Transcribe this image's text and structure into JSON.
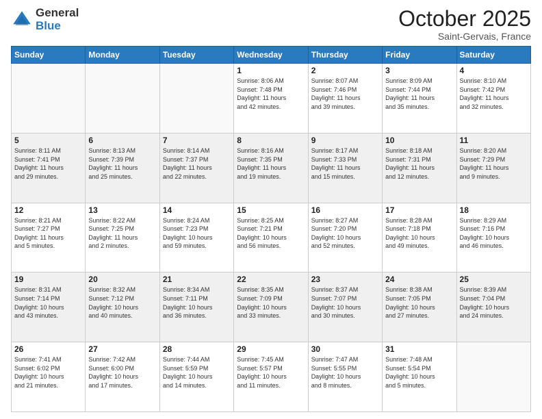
{
  "logo": {
    "general": "General",
    "blue": "Blue"
  },
  "header": {
    "month": "October 2025",
    "location": "Saint-Gervais, France"
  },
  "weekdays": [
    "Sunday",
    "Monday",
    "Tuesday",
    "Wednesday",
    "Thursday",
    "Friday",
    "Saturday"
  ],
  "weeks": [
    [
      {
        "day": "",
        "info": ""
      },
      {
        "day": "",
        "info": ""
      },
      {
        "day": "",
        "info": ""
      },
      {
        "day": "1",
        "info": "Sunrise: 8:06 AM\nSunset: 7:48 PM\nDaylight: 11 hours\nand 42 minutes."
      },
      {
        "day": "2",
        "info": "Sunrise: 8:07 AM\nSunset: 7:46 PM\nDaylight: 11 hours\nand 39 minutes."
      },
      {
        "day": "3",
        "info": "Sunrise: 8:09 AM\nSunset: 7:44 PM\nDaylight: 11 hours\nand 35 minutes."
      },
      {
        "day": "4",
        "info": "Sunrise: 8:10 AM\nSunset: 7:42 PM\nDaylight: 11 hours\nand 32 minutes."
      }
    ],
    [
      {
        "day": "5",
        "info": "Sunrise: 8:11 AM\nSunset: 7:41 PM\nDaylight: 11 hours\nand 29 minutes."
      },
      {
        "day": "6",
        "info": "Sunrise: 8:13 AM\nSunset: 7:39 PM\nDaylight: 11 hours\nand 25 minutes."
      },
      {
        "day": "7",
        "info": "Sunrise: 8:14 AM\nSunset: 7:37 PM\nDaylight: 11 hours\nand 22 minutes."
      },
      {
        "day": "8",
        "info": "Sunrise: 8:16 AM\nSunset: 7:35 PM\nDaylight: 11 hours\nand 19 minutes."
      },
      {
        "day": "9",
        "info": "Sunrise: 8:17 AM\nSunset: 7:33 PM\nDaylight: 11 hours\nand 15 minutes."
      },
      {
        "day": "10",
        "info": "Sunrise: 8:18 AM\nSunset: 7:31 PM\nDaylight: 11 hours\nand 12 minutes."
      },
      {
        "day": "11",
        "info": "Sunrise: 8:20 AM\nSunset: 7:29 PM\nDaylight: 11 hours\nand 9 minutes."
      }
    ],
    [
      {
        "day": "12",
        "info": "Sunrise: 8:21 AM\nSunset: 7:27 PM\nDaylight: 11 hours\nand 5 minutes."
      },
      {
        "day": "13",
        "info": "Sunrise: 8:22 AM\nSunset: 7:25 PM\nDaylight: 11 hours\nand 2 minutes."
      },
      {
        "day": "14",
        "info": "Sunrise: 8:24 AM\nSunset: 7:23 PM\nDaylight: 10 hours\nand 59 minutes."
      },
      {
        "day": "15",
        "info": "Sunrise: 8:25 AM\nSunset: 7:21 PM\nDaylight: 10 hours\nand 56 minutes."
      },
      {
        "day": "16",
        "info": "Sunrise: 8:27 AM\nSunset: 7:20 PM\nDaylight: 10 hours\nand 52 minutes."
      },
      {
        "day": "17",
        "info": "Sunrise: 8:28 AM\nSunset: 7:18 PM\nDaylight: 10 hours\nand 49 minutes."
      },
      {
        "day": "18",
        "info": "Sunrise: 8:29 AM\nSunset: 7:16 PM\nDaylight: 10 hours\nand 46 minutes."
      }
    ],
    [
      {
        "day": "19",
        "info": "Sunrise: 8:31 AM\nSunset: 7:14 PM\nDaylight: 10 hours\nand 43 minutes."
      },
      {
        "day": "20",
        "info": "Sunrise: 8:32 AM\nSunset: 7:12 PM\nDaylight: 10 hours\nand 40 minutes."
      },
      {
        "day": "21",
        "info": "Sunrise: 8:34 AM\nSunset: 7:11 PM\nDaylight: 10 hours\nand 36 minutes."
      },
      {
        "day": "22",
        "info": "Sunrise: 8:35 AM\nSunset: 7:09 PM\nDaylight: 10 hours\nand 33 minutes."
      },
      {
        "day": "23",
        "info": "Sunrise: 8:37 AM\nSunset: 7:07 PM\nDaylight: 10 hours\nand 30 minutes."
      },
      {
        "day": "24",
        "info": "Sunrise: 8:38 AM\nSunset: 7:05 PM\nDaylight: 10 hours\nand 27 minutes."
      },
      {
        "day": "25",
        "info": "Sunrise: 8:39 AM\nSunset: 7:04 PM\nDaylight: 10 hours\nand 24 minutes."
      }
    ],
    [
      {
        "day": "26",
        "info": "Sunrise: 7:41 AM\nSunset: 6:02 PM\nDaylight: 10 hours\nand 21 minutes."
      },
      {
        "day": "27",
        "info": "Sunrise: 7:42 AM\nSunset: 6:00 PM\nDaylight: 10 hours\nand 17 minutes."
      },
      {
        "day": "28",
        "info": "Sunrise: 7:44 AM\nSunset: 5:59 PM\nDaylight: 10 hours\nand 14 minutes."
      },
      {
        "day": "29",
        "info": "Sunrise: 7:45 AM\nSunset: 5:57 PM\nDaylight: 10 hours\nand 11 minutes."
      },
      {
        "day": "30",
        "info": "Sunrise: 7:47 AM\nSunset: 5:55 PM\nDaylight: 10 hours\nand 8 minutes."
      },
      {
        "day": "31",
        "info": "Sunrise: 7:48 AM\nSunset: 5:54 PM\nDaylight: 10 hours\nand 5 minutes."
      },
      {
        "day": "",
        "info": ""
      }
    ]
  ]
}
